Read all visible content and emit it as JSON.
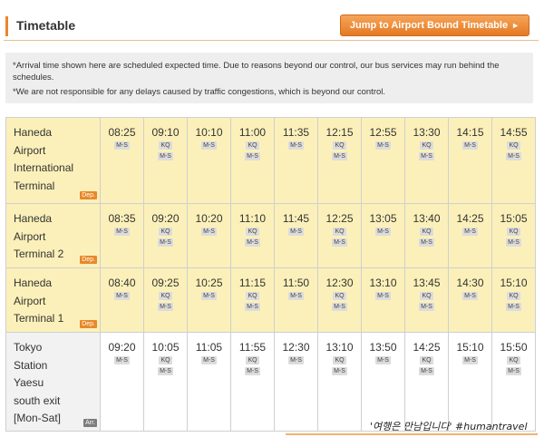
{
  "header": {
    "title": "Timetable",
    "jump_button": "Jump to Airport Bound Timetable",
    "jump_arrow": "►"
  },
  "notice": {
    "line1": "*Arrival time shown here are scheduled expected time. Due to reasons beyond our control, our bus services may run behind the schedules.",
    "line2": "*We are not responsible for any delays caused by traffic congestions, which is beyond our control."
  },
  "colors": {
    "accent": "#e8882a",
    "dep_row_bg": "#fbf0b9",
    "arr_row_bg": "#ffffff"
  },
  "rows": [
    {
      "stop_lines": [
        "Haneda",
        "Airport",
        "International",
        "Terminal"
      ],
      "tag": "Dep.",
      "type": "dep",
      "times": [
        {
          "time": "08:25",
          "badges": [
            "M-S"
          ]
        },
        {
          "time": "09:10",
          "badges": [
            "KQ",
            "M-S"
          ]
        },
        {
          "time": "10:10",
          "badges": [
            "M-S"
          ]
        },
        {
          "time": "11:00",
          "badges": [
            "KQ",
            "M-S"
          ]
        },
        {
          "time": "11:35",
          "badges": [
            "M-S"
          ]
        },
        {
          "time": "12:15",
          "badges": [
            "KQ",
            "M-S"
          ]
        },
        {
          "time": "12:55",
          "badges": [
            "M-S"
          ]
        },
        {
          "time": "13:30",
          "badges": [
            "KQ",
            "M-S"
          ]
        },
        {
          "time": "14:15",
          "badges": [
            "M-S"
          ]
        },
        {
          "time": "14:55",
          "badges": [
            "KQ",
            "M-S"
          ]
        }
      ]
    },
    {
      "stop_lines": [
        "Haneda",
        "Airport",
        "Terminal 2"
      ],
      "tag": "Dep.",
      "type": "dep",
      "times": [
        {
          "time": "08:35",
          "badges": [
            "M-S"
          ]
        },
        {
          "time": "09:20",
          "badges": [
            "KQ",
            "M-S"
          ]
        },
        {
          "time": "10:20",
          "badges": [
            "M-S"
          ]
        },
        {
          "time": "11:10",
          "badges": [
            "KQ",
            "M-S"
          ]
        },
        {
          "time": "11:45",
          "badges": [
            "M-S"
          ]
        },
        {
          "time": "12:25",
          "badges": [
            "KQ",
            "M-S"
          ]
        },
        {
          "time": "13:05",
          "badges": [
            "M-S"
          ]
        },
        {
          "time": "13:40",
          "badges": [
            "KQ",
            "M-S"
          ]
        },
        {
          "time": "14:25",
          "badges": [
            "M-S"
          ]
        },
        {
          "time": "15:05",
          "badges": [
            "KQ",
            "M-S"
          ]
        }
      ]
    },
    {
      "stop_lines": [
        "Haneda",
        "Airport",
        "Terminal 1"
      ],
      "tag": "Dep.",
      "type": "dep",
      "times": [
        {
          "time": "08:40",
          "badges": [
            "M-S"
          ]
        },
        {
          "time": "09:25",
          "badges": [
            "KQ",
            "M-S"
          ]
        },
        {
          "time": "10:25",
          "badges": [
            "M-S"
          ]
        },
        {
          "time": "11:15",
          "badges": [
            "KQ",
            "M-S"
          ]
        },
        {
          "time": "11:50",
          "badges": [
            "M-S"
          ]
        },
        {
          "time": "12:30",
          "badges": [
            "KQ",
            "M-S"
          ]
        },
        {
          "time": "13:10",
          "badges": [
            "M-S"
          ]
        },
        {
          "time": "13:45",
          "badges": [
            "KQ",
            "M-S"
          ]
        },
        {
          "time": "14:30",
          "badges": [
            "M-S"
          ]
        },
        {
          "time": "15:10",
          "badges": [
            "KQ",
            "M-S"
          ]
        }
      ]
    },
    {
      "stop_lines": [
        "Tokyo",
        "Station",
        "Yaesu",
        "south exit",
        "[Mon-Sat]"
      ],
      "tag": "Arr.",
      "type": "arr",
      "times": [
        {
          "time": "09:20",
          "badges": [
            "M-S"
          ]
        },
        {
          "time": "10:05",
          "badges": [
            "KQ",
            "M-S"
          ]
        },
        {
          "time": "11:05",
          "badges": [
            "M-S"
          ]
        },
        {
          "time": "11:55",
          "badges": [
            "KQ",
            "M-S"
          ]
        },
        {
          "time": "12:30",
          "badges": [
            "M-S"
          ]
        },
        {
          "time": "13:10",
          "badges": [
            "KQ",
            "M-S"
          ]
        },
        {
          "time": "13:50",
          "badges": [
            "M-S"
          ]
        },
        {
          "time": "14:25",
          "badges": [
            "KQ",
            "M-S"
          ]
        },
        {
          "time": "15:10",
          "badges": [
            "M-S"
          ]
        },
        {
          "time": "15:50",
          "badges": [
            "KQ",
            "M-S"
          ]
        }
      ]
    }
  ],
  "watermark": "'여행은 만남입니다' #humantravel"
}
